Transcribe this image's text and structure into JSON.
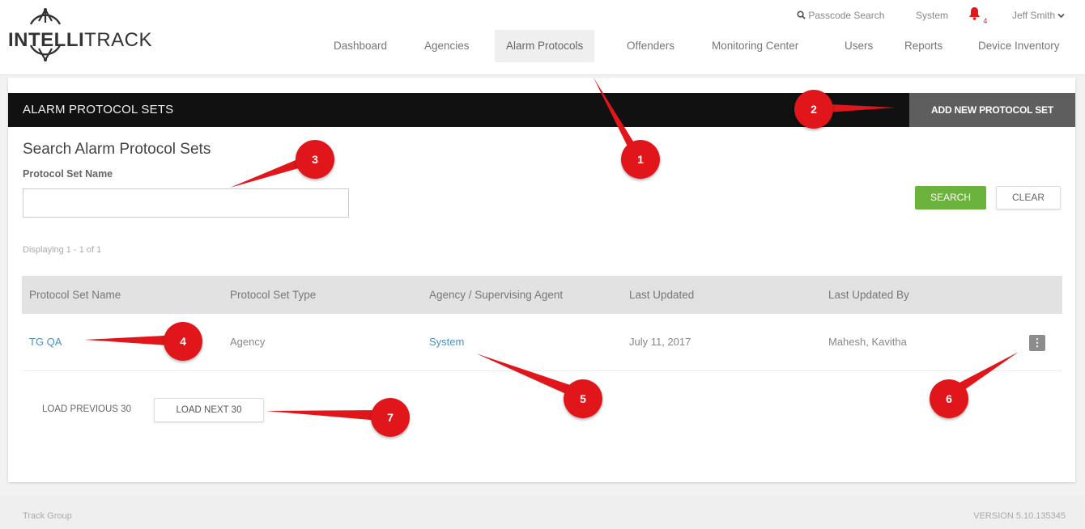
{
  "header": {
    "logo_text_bold": "INTELLI",
    "logo_text_rest": "TRACK",
    "passcode_search": "Passcode Search",
    "system_label": "System",
    "notification_count": "4",
    "user_name": "Jeff Smith",
    "nav": [
      {
        "label": "Dashboard"
      },
      {
        "label": "Agencies"
      },
      {
        "label": "Alarm Protocols"
      },
      {
        "label": "Offenders"
      },
      {
        "label": "Monitoring Center"
      },
      {
        "label": "Users"
      },
      {
        "label": "Reports"
      },
      {
        "label": "Device Inventory"
      }
    ]
  },
  "panel": {
    "title": "ALARM PROTOCOL SETS",
    "add_button": "ADD NEW PROTOCOL SET"
  },
  "search": {
    "title": "Search Alarm Protocol Sets",
    "field_label": "Protocol Set Name",
    "field_value": "",
    "search_button": "SEARCH",
    "clear_button": "CLEAR"
  },
  "results": {
    "displaying": "Displaying 1 - 1 of 1",
    "columns": [
      "Protocol Set Name",
      "Protocol Set Type",
      "Agency / Supervising Agent",
      "Last Updated",
      "Last Updated By"
    ],
    "rows": [
      {
        "name": "TG QA",
        "type": "Agency",
        "agent": "System",
        "updated": "July 11, 2017",
        "updated_by": "Mahesh, Kavitha"
      }
    ]
  },
  "pager": {
    "previous": "LOAD PREVIOUS 30",
    "next": "LOAD NEXT 30"
  },
  "footer": {
    "left": "Track Group",
    "right": "VERSION 5.10.135345"
  },
  "callouts": [
    "1",
    "2",
    "3",
    "4",
    "5",
    "6",
    "7"
  ],
  "colors": {
    "header_bar": "#111111",
    "search_green": "#6cb33e",
    "link_blue": "#4a90c8",
    "callout_red": "#e0161b",
    "bell_red": "#e0161b"
  }
}
